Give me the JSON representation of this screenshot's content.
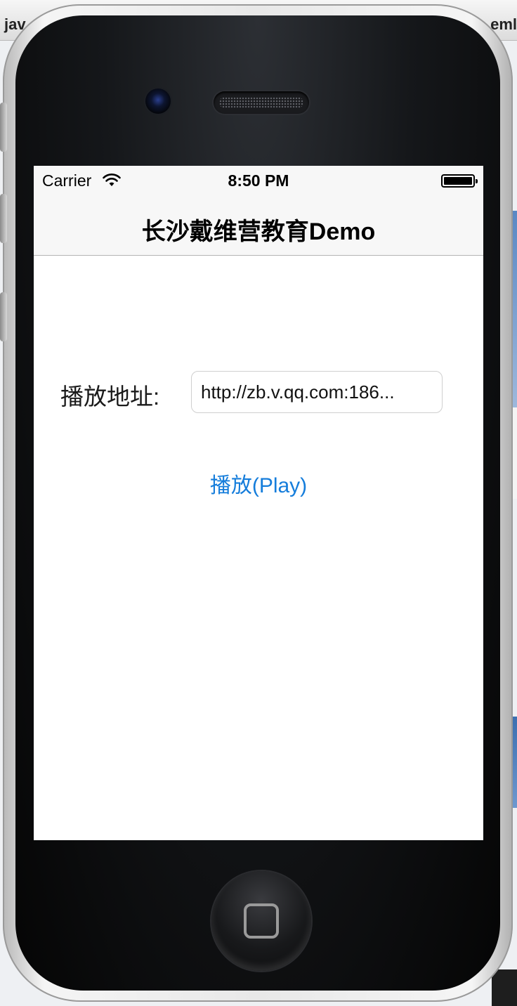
{
  "background": {
    "tab_left_text": "jav",
    "tab_right_text": "eml"
  },
  "status_bar": {
    "carrier": "Carrier",
    "time": "8:50 PM",
    "wifi_icon": "wifi-icon",
    "battery_icon": "battery-full-icon"
  },
  "nav_bar": {
    "title": "长沙戴维营教育Demo"
  },
  "form": {
    "url_label": "播放地址:",
    "url_value": "http://zb.v.qq.com:186..."
  },
  "play_button": {
    "label": "播放(Play)"
  },
  "colors": {
    "accent": "#157ddb",
    "bar_background": "#f7f7f7"
  }
}
